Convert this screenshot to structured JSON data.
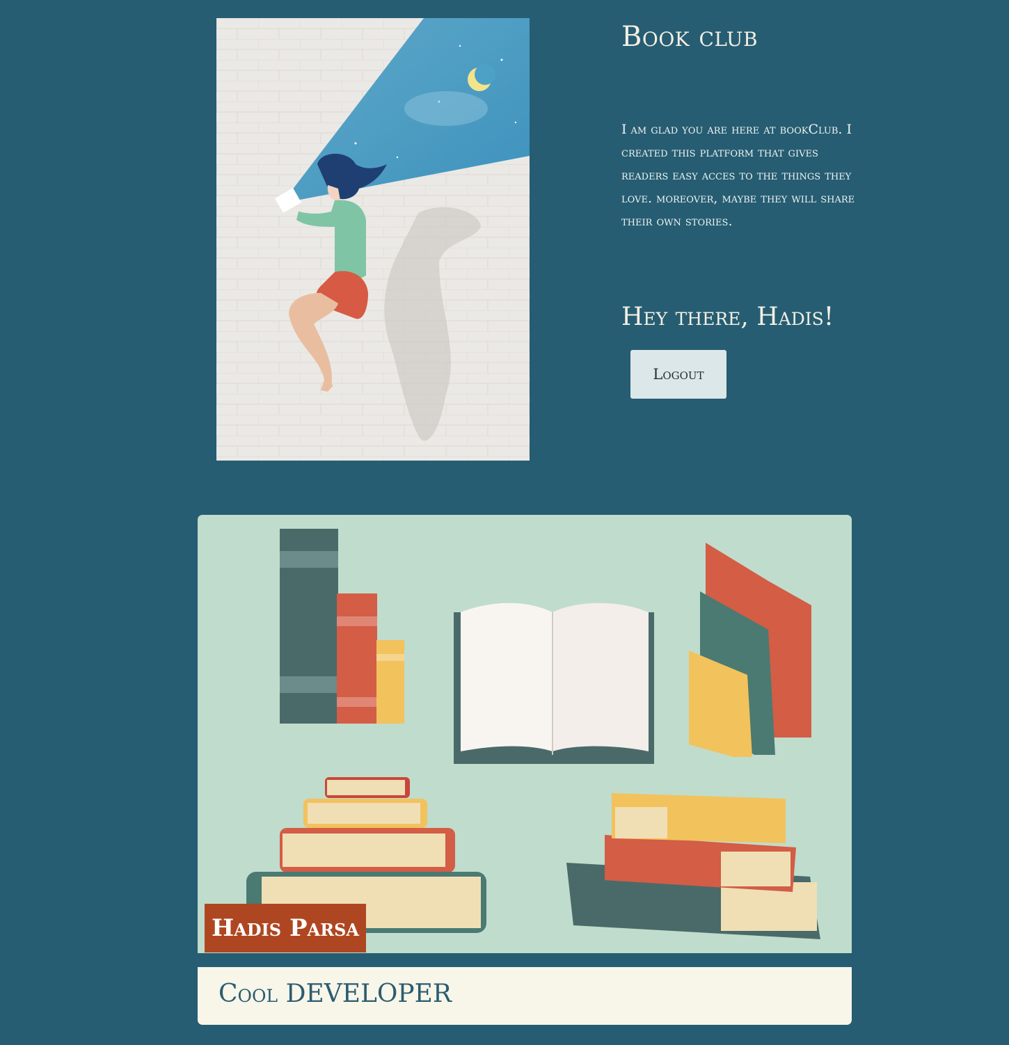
{
  "header": {
    "title": "Book club"
  },
  "intro": {
    "text": "I am glad you are here at bookClub. I created this platform that gives readers easy acces to the things they love. moreover, maybe they will share their own stories."
  },
  "user": {
    "greeting": "Hey there, Hadis!",
    "logout_label": "Logout"
  },
  "profile_card": {
    "name": "Hadis Parsa",
    "role": "Cool DEVELOPER"
  },
  "colors": {
    "background": "#265d72",
    "button": "#dce7e9",
    "name_tag": "#ae4721",
    "role_bar": "#f8f5e9",
    "books_bg": "#c0dccc"
  },
  "images": {
    "hero": "girl-reading-illustration",
    "card": "books-illustration"
  }
}
